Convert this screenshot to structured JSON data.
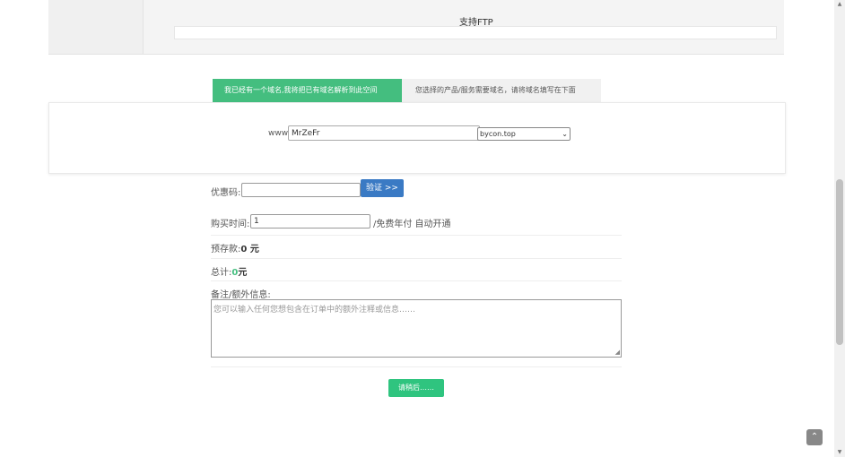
{
  "top_panel": {
    "ftp_text": "支持FTP"
  },
  "tabs": [
    {
      "label": "我已经有一个域名,我将把已有域名解析到此空间",
      "active": true
    },
    {
      "label": "您选择的产品/服务需要域名，请将域名填写在下面",
      "active": false
    }
  ],
  "domain": {
    "www_label": "www.",
    "input_value": "MrZeFr",
    "tld_selected": "bycon.top"
  },
  "coupon": {
    "label": "优惠码:",
    "value": "",
    "verify_label": "验证 >>"
  },
  "purchase": {
    "label": "购买时间:",
    "value": "1",
    "suffix": "/免费年付 自动开通"
  },
  "deposit": {
    "label": "预存款:",
    "amount": "0 元"
  },
  "total": {
    "label": "总计:",
    "amount": "0",
    "unit": "元"
  },
  "notes": {
    "label": "备注/额外信息:",
    "placeholder": "您可以输入任何您想包含在订单中的额外注释或信息……"
  },
  "submit": {
    "label": "请稍后……"
  },
  "colors": {
    "accent_green": "#44be7f",
    "button_blue": "#3a7ac4",
    "submit_green": "#2fc47f"
  }
}
